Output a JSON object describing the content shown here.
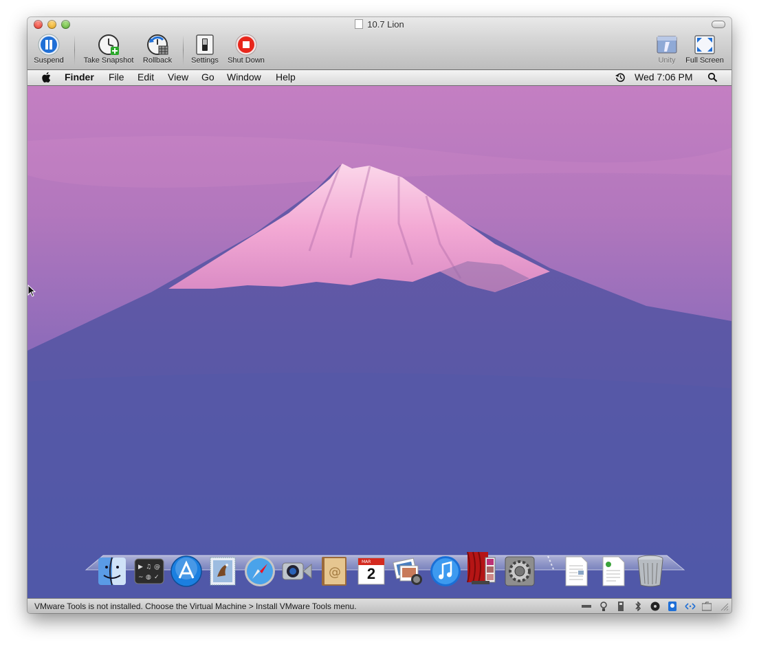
{
  "window": {
    "title": "10.7 Lion"
  },
  "toolbar": {
    "suspend": "Suspend",
    "take_snapshot": "Take Snapshot",
    "rollback": "Rollback",
    "settings": "Settings",
    "shut_down": "Shut Down",
    "unity": "Unity",
    "full_screen": "Full Screen"
  },
  "menubar": {
    "app": "Finder",
    "items": [
      "File",
      "Edit",
      "View",
      "Go",
      "Window",
      "Help"
    ],
    "clock": "Wed 7:06 PM"
  },
  "calendar_icon": {
    "month": "MAR",
    "day": "2"
  },
  "dock": [
    "finder-icon",
    "dashboard-icon",
    "app-store-icon",
    "mail-icon",
    "safari-icon",
    "facetime-icon",
    "address-book-icon",
    "ical-icon",
    "iphoto-icon",
    "itunes-icon",
    "photo-booth-icon",
    "system-preferences-icon",
    "document-icon",
    "document-icon",
    "trash-icon"
  ],
  "status": {
    "message": "VMware Tools is not installed. Choose the Virtual Machine > Install VMware Tools menu."
  },
  "colors": {
    "sky_top": "#c77fc0",
    "sky_mid": "#8e6ab8",
    "mountain": "#4f4f9e",
    "snow": "#f3b6d9",
    "shutdown_red": "#e8261b",
    "suspend_blue": "#1f6fd6"
  }
}
